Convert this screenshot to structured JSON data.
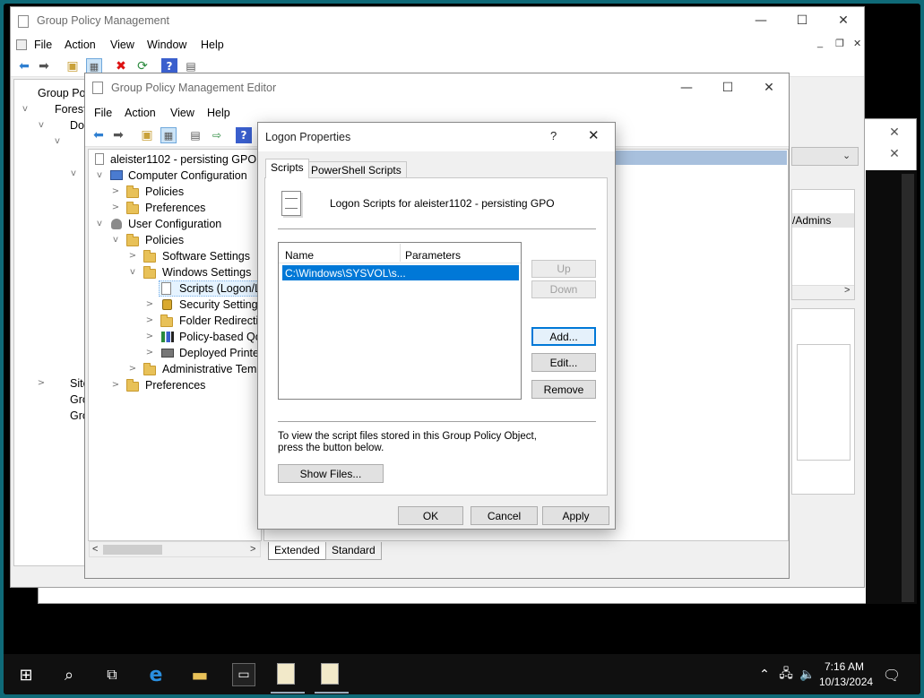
{
  "gpm": {
    "title": "Group Policy Management",
    "menu": [
      "File",
      "Action",
      "View",
      "Window",
      "Help"
    ],
    "tree": [
      "Group Poli",
      "Forest:",
      "Dor",
      "Site",
      "Gro",
      "Gro"
    ],
    "right_text": "/Admins"
  },
  "gpme": {
    "title": "Group Policy Management Editor",
    "menu": [
      "File",
      "Action",
      "View",
      "Help"
    ],
    "tree": {
      "root": "aleister1102 - persisting GPO [TI",
      "computer_config": "Computer Configuration",
      "cc_policies": "Policies",
      "cc_preferences": "Preferences",
      "user_config": "User Configuration",
      "uc_policies": "Policies",
      "software_settings": "Software Settings",
      "windows_settings": "Windows Settings",
      "scripts": "Scripts (Logon/Lo",
      "security_settings": "Security Settings",
      "folder_redirection": "Folder Redirectio",
      "policy_qos": "Policy-based QoS",
      "deployed_printers": "Deployed Printers",
      "admin_templates": "Administrative Temp",
      "uc_preferences": "Preferences"
    },
    "bottom_tabs": [
      "Extended",
      "Standard"
    ]
  },
  "dialog": {
    "title": "Logon Properties",
    "help": "?",
    "close": "✕",
    "tabs": [
      "Scripts",
      "PowerShell Scripts"
    ],
    "header": "Logon Scripts for aleister1102 - persisting GPO",
    "columns": [
      "Name",
      "Parameters"
    ],
    "rows": [
      {
        "name": "C:\\Windows\\SYSVOL\\s...",
        "params": ""
      }
    ],
    "buttons": {
      "up": "Up",
      "down": "Down",
      "add": "Add...",
      "edit": "Edit...",
      "remove": "Remove"
    },
    "info": "To view the script files stored in this Group Policy Object, press the button below.",
    "show_files": "Show Files...",
    "ok": "OK",
    "cancel": "Cancel",
    "apply": "Apply"
  },
  "taskbar": {
    "time": "7:16 AM",
    "date": "10/13/2024"
  },
  "colors": {
    "accent": "#0078d7",
    "selection": "#0078d7",
    "frame": "#0f6a78"
  }
}
